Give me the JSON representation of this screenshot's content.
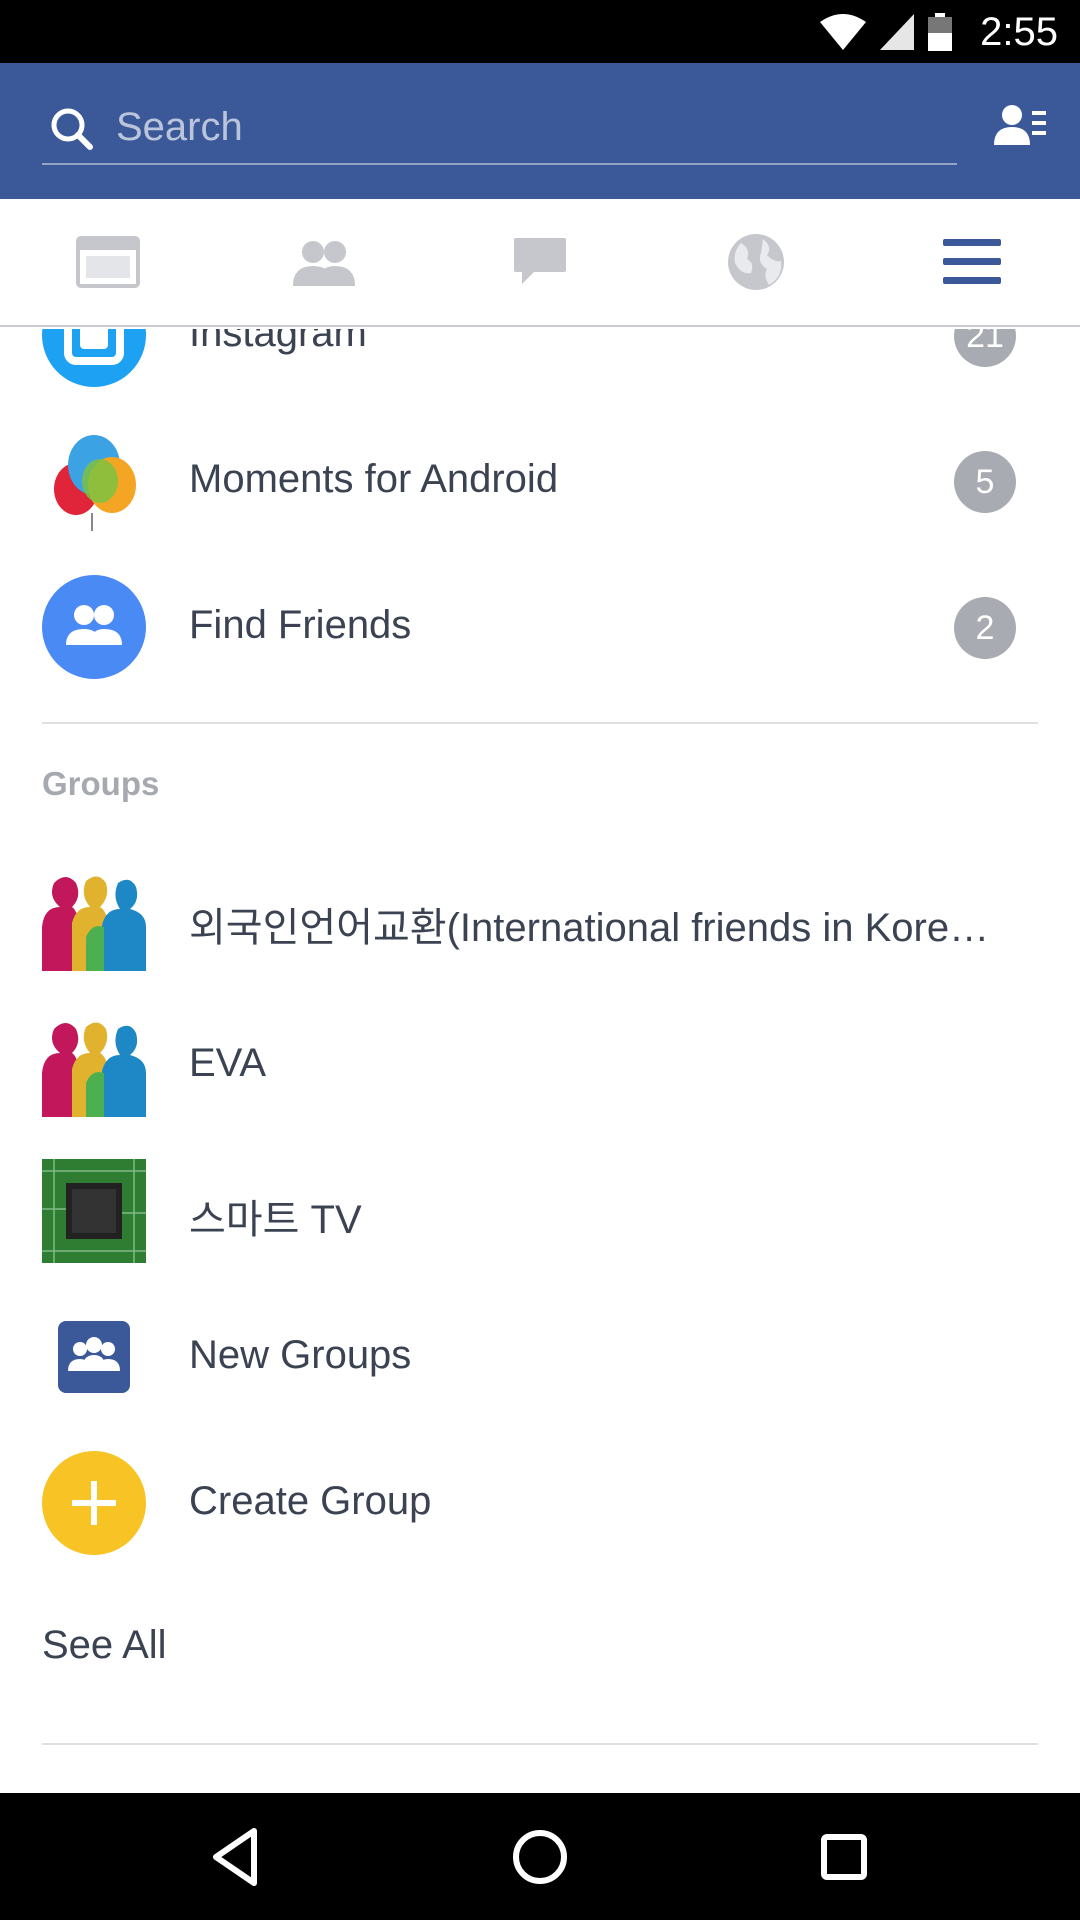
{
  "status_bar": {
    "time": "2:55"
  },
  "search": {
    "placeholder": "Search"
  },
  "tabs": [
    {
      "name": "news-feed"
    },
    {
      "name": "friend-requests"
    },
    {
      "name": "messages"
    },
    {
      "name": "notifications"
    },
    {
      "name": "menu",
      "active": true
    }
  ],
  "colors": {
    "brand": "#3b5998",
    "badge": "#a9abb2",
    "text": "#3b4352",
    "section": "#a6a9b0",
    "create_group": "#f7c325"
  },
  "apps": [
    {
      "label": "Instagram",
      "badge": "21",
      "icon": "instagram-icon"
    },
    {
      "label": "Moments for Android",
      "badge": "5",
      "icon": "moments-balloons-icon"
    },
    {
      "label": "Find Friends",
      "badge": "2",
      "icon": "find-friends-icon"
    }
  ],
  "groups_section": {
    "title": "Groups",
    "items": [
      {
        "label": "외국인언어교환(International friends in Kore…",
        "icon": "group-people-icon"
      },
      {
        "label": "EVA",
        "icon": "group-people-icon"
      },
      {
        "label": "스마트 TV",
        "icon": "circuit-chip-icon"
      },
      {
        "label": "New Groups",
        "icon": "new-groups-icon"
      },
      {
        "label": "Create Group",
        "icon": "plus-icon"
      }
    ],
    "see_all": "See All"
  }
}
